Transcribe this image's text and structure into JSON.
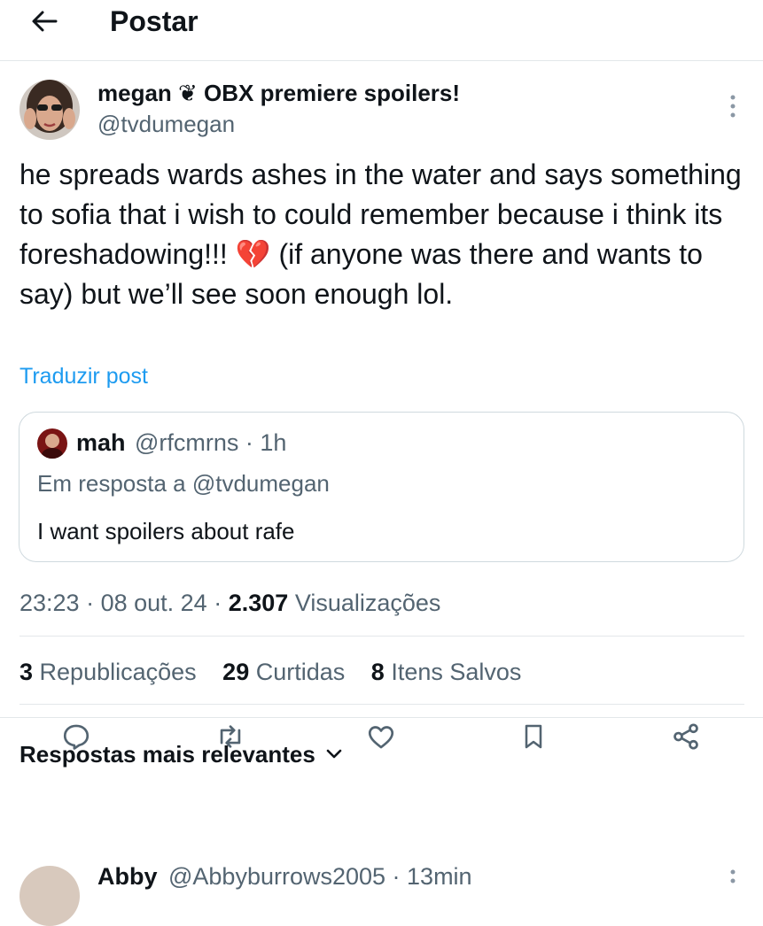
{
  "header": {
    "title": "Postar"
  },
  "post": {
    "author_name": "megan ❦ OBX premiere spoilers!",
    "author_handle": "@tvdumegan",
    "text": "he spreads wards ashes in the water and says something to sofia that i wish to could remember because i think its foreshadowing!!! 💔 (if anyone was there and wants to say) but we’ll see soon enough lol.",
    "translate_label": "Traduzir post",
    "time": "23:23",
    "date": "08 out. 24",
    "views_count": "2.307",
    "views_label": "Visualizações",
    "stats": {
      "reposts_count": "3",
      "reposts_label": "Republicações",
      "likes_count": "29",
      "likes_label": "Curtidas",
      "bookmarks_count": "8",
      "bookmarks_label": "Itens Salvos"
    }
  },
  "quoted": {
    "name": "mah",
    "handle_time": "@rfcmrns · 1h",
    "reply_to": "Em resposta a @tvdumegan",
    "text": "I want spoilers about rafe"
  },
  "actions": [
    "reply-icon",
    "repost-icon",
    "like-icon",
    "bookmark-icon",
    "share-icon"
  ],
  "replies_header": "Respostas mais relevantes",
  "reply": {
    "name": "Abby",
    "handle_time": "@Abbyburrows2005 · 13min"
  },
  "colors": {
    "accent": "#1d9bf0",
    "text": "#0f1419",
    "secondary": "#536471",
    "border": "#cfd9de"
  }
}
